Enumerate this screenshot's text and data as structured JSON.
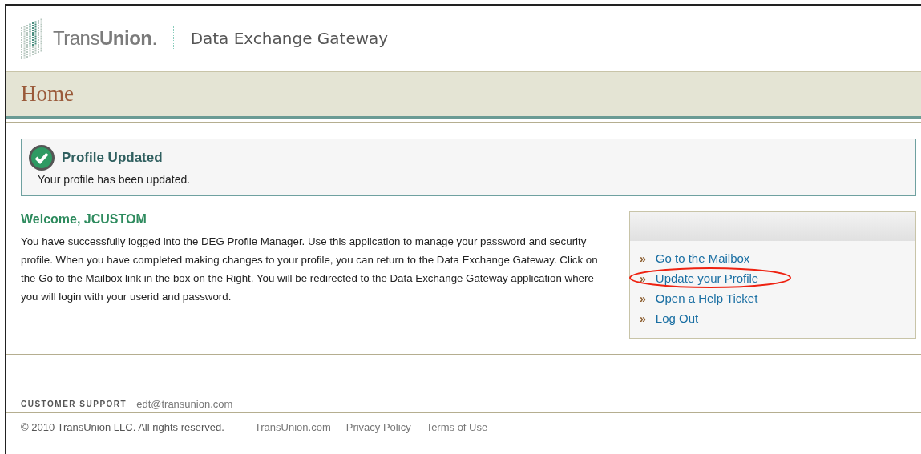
{
  "header": {
    "brand": "Trans**Union**.",
    "product": "Data Exchange Gateway"
  },
  "page_title": "Home",
  "alert": {
    "title": "Profile Updated",
    "message": "Your profile has been updated."
  },
  "welcome": {
    "heading": "Welcome, JCUSTOM",
    "body": "You have successfully logged into the DEG Profile Manager. Use this application to manage your password and security profile. When you have completed making changes to your profile, you can return to the Data Exchange Gateway. Click on the Go to the Mailbox link in the box on the Right. You will be redirected to the Data Exchange Gateway application where you will login with your userid and password."
  },
  "links": [
    {
      "bullet": "»",
      "label": "Go to the Mailbox",
      "circled": false
    },
    {
      "bullet": "»",
      "label": "Update your Profile",
      "circled": true
    },
    {
      "bullet": "»",
      "label": "Open a Help Ticket",
      "circled": false
    },
    {
      "bullet": "»",
      "label": "Log Out",
      "circled": false
    }
  ],
  "footer": {
    "support_label": "CUSTOMER SUPPORT",
    "support_email": "edt@transunion.com",
    "copyright": "© 2010 TransUnion LLC. All rights reserved.",
    "links": [
      "TransUnion.com",
      "Privacy Policy",
      "Terms of Use"
    ]
  }
}
